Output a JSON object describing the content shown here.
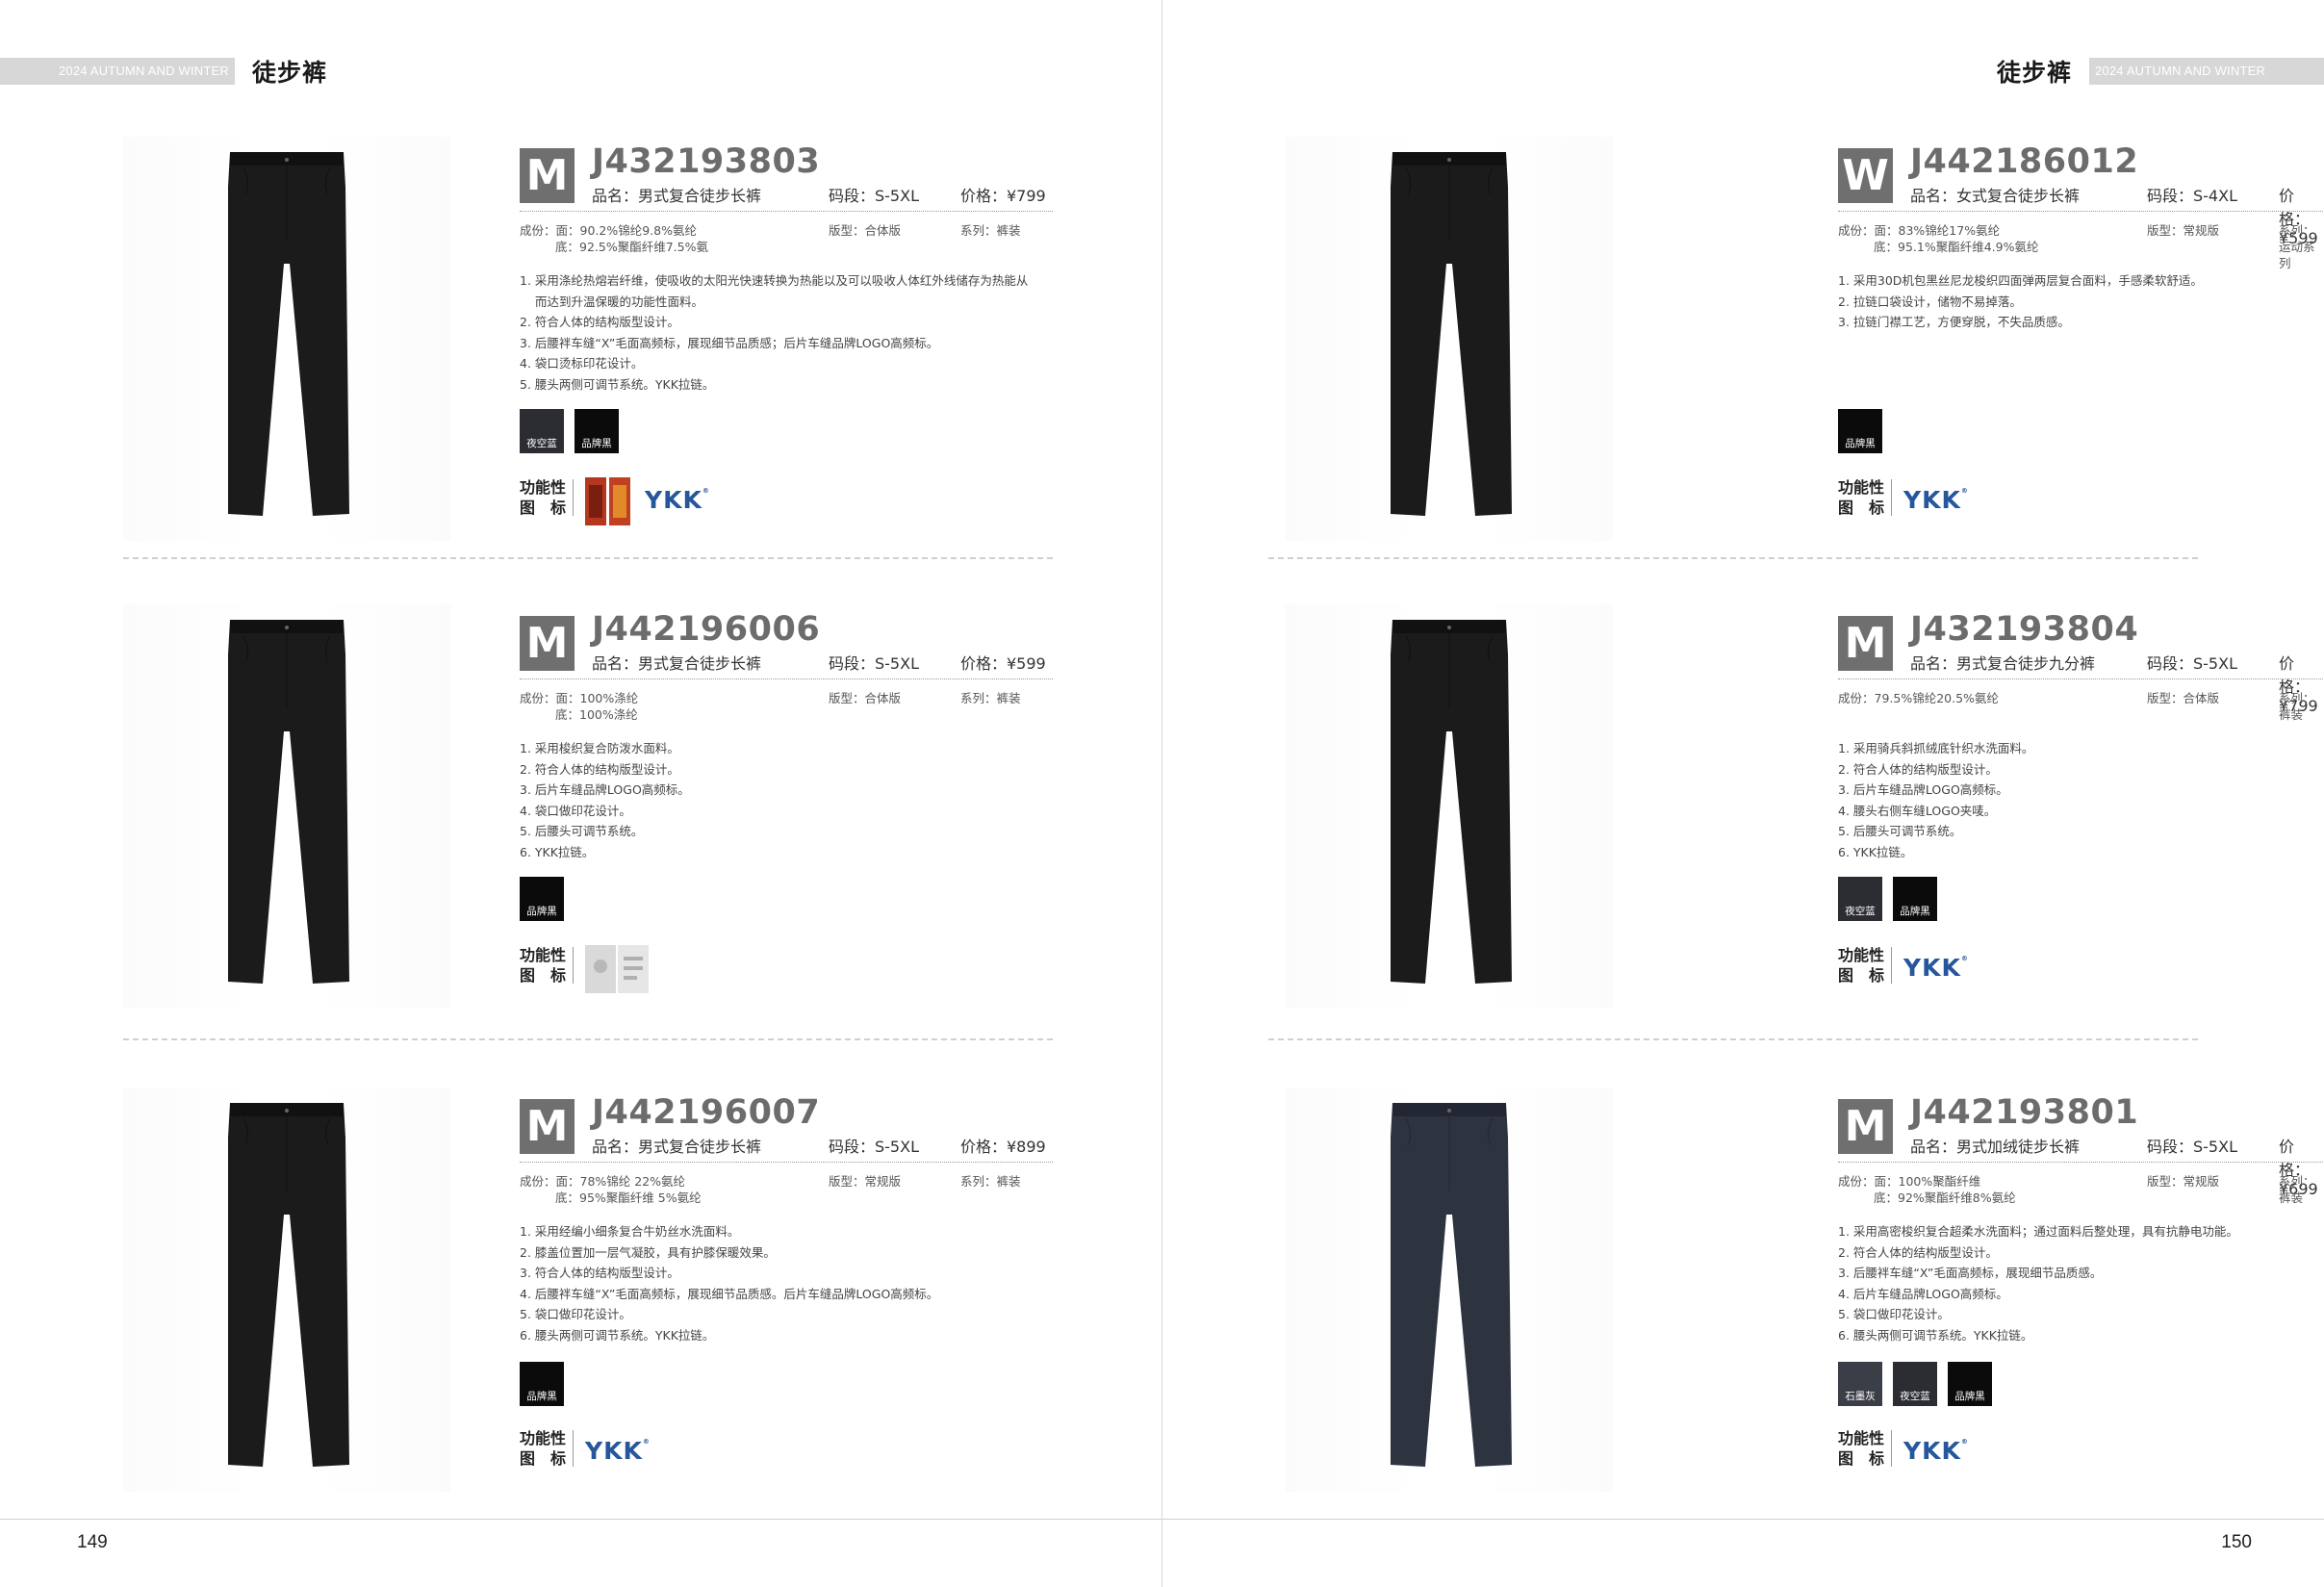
{
  "header": {
    "season": "2024 AUTUMN AND WINTER",
    "category": "徒步裤"
  },
  "pages": {
    "left_number": "149",
    "right_number": "150"
  },
  "products": [
    {
      "gender": "M",
      "code": "J432193803",
      "name": "品名：男式复合徒步长裤",
      "size": "码段：S-5XL",
      "price": "价格：¥799",
      "composition_1": "成份：面：90.2%锦纶9.8%氨纶",
      "composition_2": "底：92.5%聚酯纤维7.5%氨",
      "fit": "版型：合体版",
      "series": "系列：裤装",
      "features": [
        "1. 采用涤纶热熔岩纤维，使吸收的太阳光快速转换为热能以及可以吸收人体红外线储存为热能从",
        "而达到升温保暖的功能性面料。",
        "2. 符合人体的结构版型设计。",
        "3. 后腰袢车缝“X”毛面高频标，展现细节品质感；后片车缝品牌LOGO高频标。",
        "4. 袋口烫标印花设计。",
        "5. 腰头两侧可调节系统。YKK拉链。"
      ],
      "colors": [
        {
          "label": "夜空蓝",
          "hex": "#2b2d33"
        },
        {
          "label": "品牌黑",
          "hex": "#0b0b0b"
        }
      ],
      "func_label_1": "功能性",
      "func_label_2": "图　标",
      "func_tag": "heat-tag-icon",
      "ykk": "YKK"
    },
    {
      "gender": "M",
      "code": "J442196006",
      "name": "品名：男式复合徒步长裤",
      "size": "码段：S-5XL",
      "price": "价格：¥599",
      "composition_1": "成份：面：100%涤纶",
      "composition_2": "底：100%涤纶",
      "fit": "版型：合体版",
      "series": "系列：裤装",
      "features": [
        "1. 采用梭织复合防泼水面料。",
        "2. 符合人体的结构版型设计。",
        "3. 后片车缝品牌LOGO高频标。",
        "4. 袋口做印花设计。",
        "5. 后腰头可调节系统。",
        "6. YKK拉链。"
      ],
      "colors": [
        {
          "label": "品牌黑",
          "hex": "#0b0b0b"
        }
      ],
      "func_label_1": "功能性",
      "func_label_2": "图　标",
      "func_tag": "water-repellent-tag-icon",
      "ykk": ""
    },
    {
      "gender": "M",
      "code": "J442196007",
      "name": "品名：男式复合徒步长裤",
      "size": "码段：S-5XL",
      "price": "价格：¥899",
      "composition_1": "成份：面：78%锦纶 22%氨纶",
      "composition_2": "底：95%聚酯纤维 5%氨纶",
      "fit": "版型：常规版",
      "series": "系列：裤装",
      "features": [
        "1. 采用经编小细条复合牛奶丝水洗面料。",
        "2. 膝盖位置加一层气凝胶，具有护膝保暖效果。",
        "3. 符合人体的结构版型设计。",
        "4. 后腰袢车缝“X”毛面高频标，展现细节品质感。后片车缝品牌LOGO高频标。",
        "5. 袋口做印花设计。",
        "6. 腰头两侧可调节系统。YKK拉链。"
      ],
      "colors": [
        {
          "label": "品牌黑",
          "hex": "#0b0b0b"
        }
      ],
      "func_label_1": "功能性",
      "func_label_2": "图　标",
      "func_tag": "",
      "ykk": "YKK"
    },
    {
      "gender": "W",
      "code": "J442186012",
      "name": "品名：女式复合徒步长裤",
      "size": "码段：S-4XL",
      "price": "价格：¥599",
      "composition_1": "成份：面：83%锦纶17%氨纶",
      "composition_2": "底：95.1%聚酯纤维4.9%氨纶",
      "fit": "版型：常规版",
      "series": "系列：运动系列",
      "features": [
        "1. 采用30D机包黑丝尼龙梭织四面弹两层复合面料，手感柔软舒适。",
        "2. 拉链口袋设计，储物不易掉落。",
        "3. 拉链门襟工艺，方便穿脱，不失品质感。"
      ],
      "colors": [
        {
          "label": "品牌黑",
          "hex": "#0b0b0b"
        }
      ],
      "func_label_1": "功能性",
      "func_label_2": "图　标",
      "func_tag": "",
      "ykk": "YKK"
    },
    {
      "gender": "M",
      "code": "J432193804",
      "name": "品名：男式复合徒步九分裤",
      "size": "码段：S-5XL",
      "price": "价格：¥799",
      "composition_1": "成份：79.5%锦纶20.5%氨纶",
      "composition_2": "",
      "fit": "版型：合体版",
      "series": "系列：裤装",
      "features": [
        "1. 采用骑兵斜抓绒底针织水洗面料。",
        "2. 符合人体的结构版型设计。",
        "3. 后片车缝品牌LOGO高频标。",
        "4. 腰头右侧车缝LOGO夹唛。",
        "5. 后腰头可调节系统。",
        "6. YKK拉链。"
      ],
      "colors": [
        {
          "label": "夜空蓝",
          "hex": "#2b2d33"
        },
        {
          "label": "品牌黑",
          "hex": "#0b0b0b"
        }
      ],
      "func_label_1": "功能性",
      "func_label_2": "图　标",
      "func_tag": "",
      "ykk": "YKK"
    },
    {
      "gender": "M",
      "code": "J442193801",
      "name": "品名：男式加绒徒步长裤",
      "size": "码段：S-5XL",
      "price": "价格：¥699",
      "composition_1": "成份：面：100%聚酯纤维",
      "composition_2": "底：92%聚酯纤维8%氨纶",
      "fit": "版型：常规版",
      "series": "系列：裤装",
      "features": [
        "1. 采用高密梭织复合超柔水洗面料；通过面料后整处理，具有抗静电功能。",
        "2. 符合人体的结构版型设计。",
        "3. 后腰袢车缝“X”毛面高频标，展现细节品质感。",
        "4. 后片车缝品牌LOGO高频标。",
        "5. 袋口做印花设计。",
        "6. 腰头两侧可调节系统。YKK拉链。"
      ],
      "colors": [
        {
          "label": "石墨灰",
          "hex": "#3a3e46"
        },
        {
          "label": "夜空蓝",
          "hex": "#2b2d33"
        },
        {
          "label": "品牌黑",
          "hex": "#0b0b0b"
        }
      ],
      "func_label_1": "功能性",
      "func_label_2": "图　标",
      "func_tag": "",
      "ykk": "YKK"
    }
  ],
  "colors": {
    "pants_black": "#1b1b1b",
    "pants_navy": "#2e3340",
    "ykk_blue": "#26569c",
    "badge_gray": "#6f6f6f"
  }
}
